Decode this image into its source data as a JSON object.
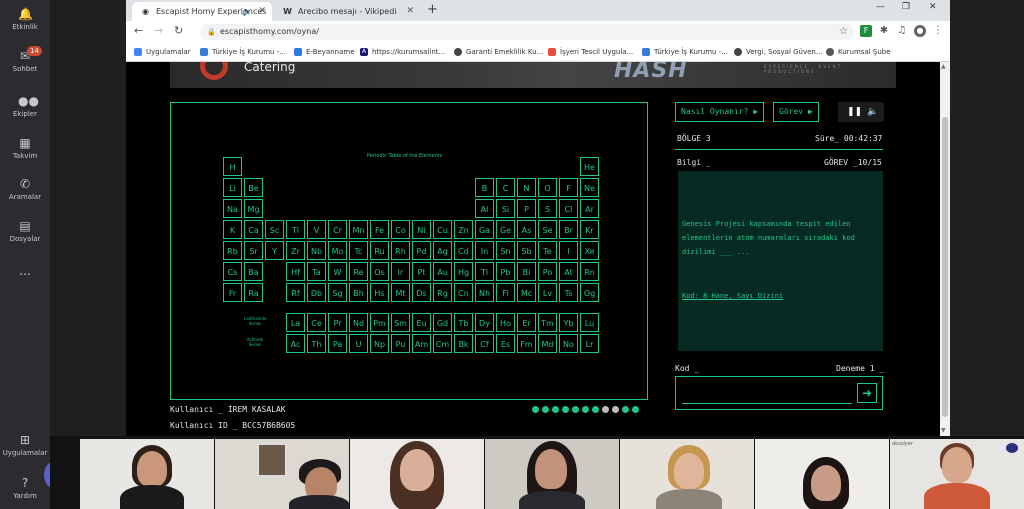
{
  "teams": {
    "rail": [
      {
        "label": "Etkinlik",
        "icon": "bell-icon",
        "glyph": "🔔"
      },
      {
        "label": "Sohbet",
        "icon": "chat-icon",
        "glyph": "✉",
        "badge": "14"
      },
      {
        "label": "Ekipler",
        "icon": "teams-icon",
        "glyph": "👥"
      },
      {
        "label": "Takvim",
        "icon": "calendar-icon",
        "glyph": "▦"
      },
      {
        "label": "Aramalar",
        "icon": "phone-icon",
        "glyph": "✆"
      },
      {
        "label": "Dosyalar",
        "icon": "files-icon",
        "glyph": "▤"
      },
      {
        "label": "...",
        "icon": "more-icon",
        "glyph": ""
      }
    ],
    "bottom": [
      {
        "label": "Uygulamalar",
        "icon": "apps-icon",
        "glyph": "⊞"
      },
      {
        "label": "Yardım",
        "icon": "help-icon",
        "glyph": "?"
      }
    ],
    "participant_count_badge": "3"
  },
  "browser": {
    "tabs": [
      {
        "title": "Escapist Homy Experiences",
        "favicon": "globe-icon",
        "active": true
      },
      {
        "title": "Arecibo mesajı - Vikipedi",
        "favicon": "wikipedia-icon",
        "active": false
      }
    ],
    "url": "escapisthomy.com/oyna/",
    "bookmarks": [
      {
        "label": "Uygulamalar",
        "icon": "apps-grid-icon",
        "color": "#4285f4"
      },
      {
        "label": "Türkiye İş Kurumu -...",
        "icon": "iskur-icon",
        "color": "#3a7bd5"
      },
      {
        "label": "E-Beyanname",
        "icon": "ebeyanname-icon",
        "color": "#2c7be5"
      },
      {
        "label": "https://kurumsalint...",
        "icon": "a-icon",
        "color": "#1a1a6e"
      },
      {
        "label": "Garanti Emeklilik Ku...",
        "icon": "garanti-icon",
        "color": "#444"
      },
      {
        "label": "İşyeri Tescil Uygula...",
        "icon": "isyeri-icon",
        "color": "#e74c3c"
      },
      {
        "label": "Türkiye İş Kurumu -...",
        "icon": "iskur2-icon",
        "color": "#3a7bd5"
      },
      {
        "label": "Vergi, Sosyal Güven...",
        "icon": "vergi-icon",
        "color": "#444"
      },
      {
        "label": "Kurumsal Şube",
        "icon": "kurumsal-icon",
        "color": "#555"
      }
    ]
  },
  "game": {
    "banner": {
      "logo_text": "Catering",
      "brand": "HASH",
      "tagline": "EXPERIENCE · EVENT · PRODUCTIONS"
    },
    "periodic_title": "Periodic Table of the Elements",
    "elements": {
      "r1": [
        "H",
        "He"
      ],
      "r2": [
        "Li",
        "Be",
        "B",
        "C",
        "N",
        "O",
        "F",
        "Ne"
      ],
      "r3": [
        "Na",
        "Mg",
        "Al",
        "Si",
        "P",
        "S",
        "Cl",
        "Ar"
      ],
      "r4": [
        "K",
        "Ca",
        "Sc",
        "Ti",
        "V",
        "Cr",
        "Mn",
        "Fe",
        "Co",
        "Ni",
        "Cu",
        "Zn",
        "Ga",
        "Ge",
        "As",
        "Se",
        "Br",
        "Kr"
      ],
      "r5": [
        "Rb",
        "Sr",
        "Y",
        "Zr",
        "Nb",
        "Mo",
        "Tc",
        "Ru",
        "Rh",
        "Pd",
        "Ag",
        "Cd",
        "In",
        "Sn",
        "Sb",
        "Te",
        "I",
        "Xe"
      ],
      "r6": [
        "Cs",
        "Ba",
        "",
        "Hf",
        "Ta",
        "W",
        "Re",
        "Os",
        "Ir",
        "Pt",
        "Au",
        "Hg",
        "Tl",
        "Pb",
        "Bi",
        "Po",
        "At",
        "Rn"
      ],
      "r7": [
        "Fr",
        "Ra",
        "",
        "Rf",
        "Db",
        "Sg",
        "Bh",
        "Hs",
        "Mt",
        "Ds",
        "Rg",
        "Cn",
        "Nh",
        "Fl",
        "Mc",
        "Lv",
        "Ts",
        "Og"
      ],
      "lanthanides": [
        "La",
        "Ce",
        "Pr",
        "Nd",
        "Pm",
        "Sm",
        "Eu",
        "Gd",
        "Tb",
        "Dy",
        "Ho",
        "Er",
        "Tm",
        "Yb",
        "Lu"
      ],
      "actinides": [
        "Ac",
        "Th",
        "Pa",
        "U",
        "Np",
        "Pu",
        "Am",
        "Cm",
        "Bk",
        "Cf",
        "Es",
        "Fm",
        "Md",
        "No",
        "Lr"
      ]
    },
    "series_labels": {
      "lanthanide": "Lanthanide Series",
      "actinide": "Actinide Series"
    },
    "how_to_play": "Nasıl Oynanır?",
    "mission_button": "Görev",
    "region": "BÖLGE 3",
    "time_label": "Süre_",
    "time_value": "00:42:37",
    "info_label": "Bilgi _",
    "mission_label": "GÖREV",
    "mission_progress": "_10/15",
    "info_text": "Genesis Projesi kapsamında tespit edilen elementlerin atom numaraları sıradaki kod dizilimi ___ ...",
    "info_hint": "Kod: 8 Hane,  Sayı Dizini",
    "code_label": "Kod _",
    "attempt_label": "Deneme 1 _",
    "user_label": "Kullanıcı _",
    "user_value": "İREM KASALAK",
    "user_id_label": "Kullanıcı ID _",
    "user_id_value": "BCC57B6B605",
    "progress_dots": {
      "total": 11,
      "filled": [
        1,
        1,
        1,
        1,
        1,
        1,
        1,
        0,
        0,
        1,
        1
      ]
    },
    "accent_color": "#1fc58a"
  },
  "video": {
    "participants": 7,
    "last_tile_caption": "dossiyer"
  }
}
